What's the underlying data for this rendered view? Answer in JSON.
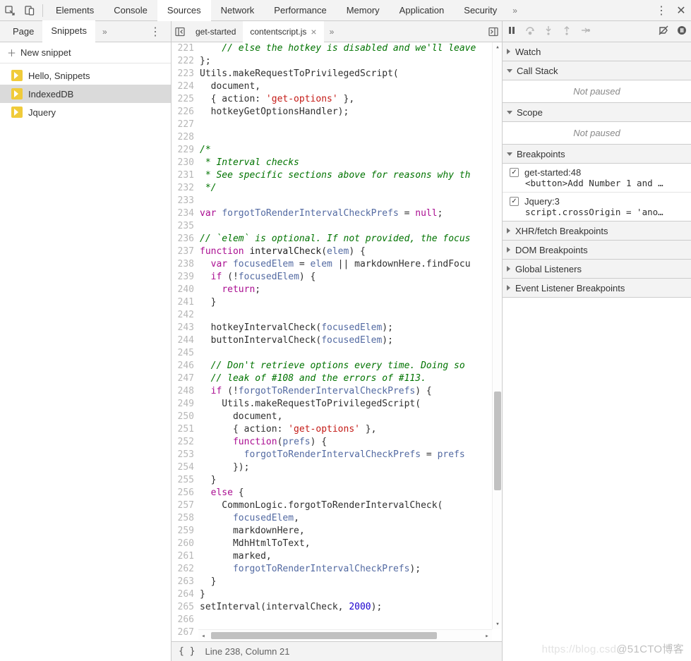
{
  "top": {
    "tabs": [
      "Elements",
      "Console",
      "Sources",
      "Network",
      "Performance",
      "Memory",
      "Application",
      "Security"
    ],
    "active": "Sources"
  },
  "left": {
    "sub_tabs": {
      "page": "Page",
      "snippets": "Snippets"
    },
    "new_snippet": "New snippet",
    "items": [
      "Hello, Snippets",
      "IndexedDB",
      "Jquery"
    ],
    "selected": 1
  },
  "center": {
    "tabs": [
      {
        "label": "get-started",
        "active": false,
        "closable": false
      },
      {
        "label": "contentscript.js",
        "active": true,
        "closable": true
      }
    ],
    "first_line": 221,
    "code_lines": [
      [
        [
          "cm",
          "    // else the hotkey is disabled and we'll leave"
        ]
      ],
      [
        [
          "p",
          "};"
        ]
      ],
      [
        [
          "p",
          "Utils.makeRequestToPrivilegedScript("
        ]
      ],
      [
        [
          "p",
          "  document,"
        ]
      ],
      [
        [
          "p",
          "  { action: "
        ],
        [
          "s",
          "'get-options'"
        ],
        [
          "p",
          " },"
        ]
      ],
      [
        [
          "p",
          "  hotkeyGetOptionsHandler);"
        ]
      ],
      [],
      [],
      [
        [
          "cm",
          "/*"
        ]
      ],
      [
        [
          "cm",
          " * Interval checks"
        ]
      ],
      [
        [
          "cm",
          " * See specific sections above for reasons why th"
        ]
      ],
      [
        [
          "cm",
          " */"
        ]
      ],
      [],
      [
        [
          "k",
          "var"
        ],
        [
          "p",
          " "
        ],
        [
          "id",
          "forgotToRenderIntervalCheckPrefs"
        ],
        [
          "p",
          " = "
        ],
        [
          "k",
          "null"
        ],
        [
          "p",
          ";"
        ]
      ],
      [],
      [
        [
          "cm",
          "// `elem` is optional. If not provided, the focus"
        ]
      ],
      [
        [
          "k",
          "function"
        ],
        [
          "p",
          " "
        ],
        [
          "fn",
          "intervalCheck"
        ],
        [
          "p",
          "("
        ],
        [
          "id",
          "elem"
        ],
        [
          "p",
          ") {"
        ]
      ],
      [
        [
          "p",
          "  "
        ],
        [
          "k",
          "var"
        ],
        [
          "p",
          " "
        ],
        [
          "id",
          "focusedElem"
        ],
        [
          "p",
          " = "
        ],
        [
          "id",
          "elem"
        ],
        [
          "p",
          " || markdownHere.findFocu"
        ]
      ],
      [
        [
          "p",
          "  "
        ],
        [
          "k",
          "if"
        ],
        [
          "p",
          " (!"
        ],
        [
          "id",
          "focusedElem"
        ],
        [
          "p",
          ") {"
        ]
      ],
      [
        [
          "p",
          "    "
        ],
        [
          "k",
          "return"
        ],
        [
          "p",
          ";"
        ]
      ],
      [
        [
          "p",
          "  }"
        ]
      ],
      [],
      [
        [
          "p",
          "  hotkeyIntervalCheck("
        ],
        [
          "id",
          "focusedElem"
        ],
        [
          "p",
          ");"
        ]
      ],
      [
        [
          "p",
          "  buttonIntervalCheck("
        ],
        [
          "id",
          "focusedElem"
        ],
        [
          "p",
          ");"
        ]
      ],
      [],
      [
        [
          "cm",
          "  // Don't retrieve options every time. Doing so"
        ]
      ],
      [
        [
          "cm",
          "  // leak of #108 and the errors of #113."
        ]
      ],
      [
        [
          "p",
          "  "
        ],
        [
          "k",
          "if"
        ],
        [
          "p",
          " (!"
        ],
        [
          "id",
          "forgotToRenderIntervalCheckPrefs"
        ],
        [
          "p",
          ") {"
        ]
      ],
      [
        [
          "p",
          "    Utils.makeRequestToPrivilegedScript("
        ]
      ],
      [
        [
          "p",
          "      document,"
        ]
      ],
      [
        [
          "p",
          "      { action: "
        ],
        [
          "s",
          "'get-options'"
        ],
        [
          "p",
          " },"
        ]
      ],
      [
        [
          "p",
          "      "
        ],
        [
          "k",
          "function"
        ],
        [
          "p",
          "("
        ],
        [
          "id",
          "prefs"
        ],
        [
          "p",
          ") {"
        ]
      ],
      [
        [
          "p",
          "        "
        ],
        [
          "id",
          "forgotToRenderIntervalCheckPrefs"
        ],
        [
          "p",
          " = "
        ],
        [
          "id",
          "prefs"
        ]
      ],
      [
        [
          "p",
          "      });"
        ]
      ],
      [
        [
          "p",
          "  }"
        ]
      ],
      [
        [
          "p",
          "  "
        ],
        [
          "k",
          "else"
        ],
        [
          "p",
          " {"
        ]
      ],
      [
        [
          "p",
          "    CommonLogic.forgotToRenderIntervalCheck("
        ]
      ],
      [
        [
          "p",
          "      "
        ],
        [
          "id",
          "focusedElem"
        ],
        [
          "p",
          ","
        ]
      ],
      [
        [
          "p",
          "      markdownHere,"
        ]
      ],
      [
        [
          "p",
          "      MdhHtmlToText,"
        ]
      ],
      [
        [
          "p",
          "      marked,"
        ]
      ],
      [
        [
          "p",
          "      "
        ],
        [
          "id",
          "forgotToRenderIntervalCheckPrefs"
        ],
        [
          "p",
          ");"
        ]
      ],
      [
        [
          "p",
          "  }"
        ]
      ],
      [
        [
          "p",
          "}"
        ]
      ],
      [
        [
          "p",
          "setInterval(intervalCheck, "
        ],
        [
          "n",
          "2000"
        ],
        [
          "p",
          ");"
        ]
      ],
      [],
      []
    ],
    "status": "Line 238, Column 21"
  },
  "right": {
    "headers": {
      "watch": "Watch",
      "call_stack": "Call Stack",
      "scope": "Scope",
      "breakpoints": "Breakpoints",
      "xhr": "XHR/fetch Breakpoints",
      "dom": "DOM Breakpoints",
      "global": "Global Listeners",
      "event": "Event Listener Breakpoints"
    },
    "not_paused": "Not paused",
    "breakpoints": [
      {
        "title": "get-started:48",
        "detail": "<button>Add Number 1 and …",
        "checked": true
      },
      {
        "title": "Jquery:3",
        "detail": "script.crossOrigin = 'ano…",
        "checked": true
      }
    ]
  },
  "watermark": {
    "faint": "https://blog.csd",
    "bold": "@51CTO博客"
  }
}
